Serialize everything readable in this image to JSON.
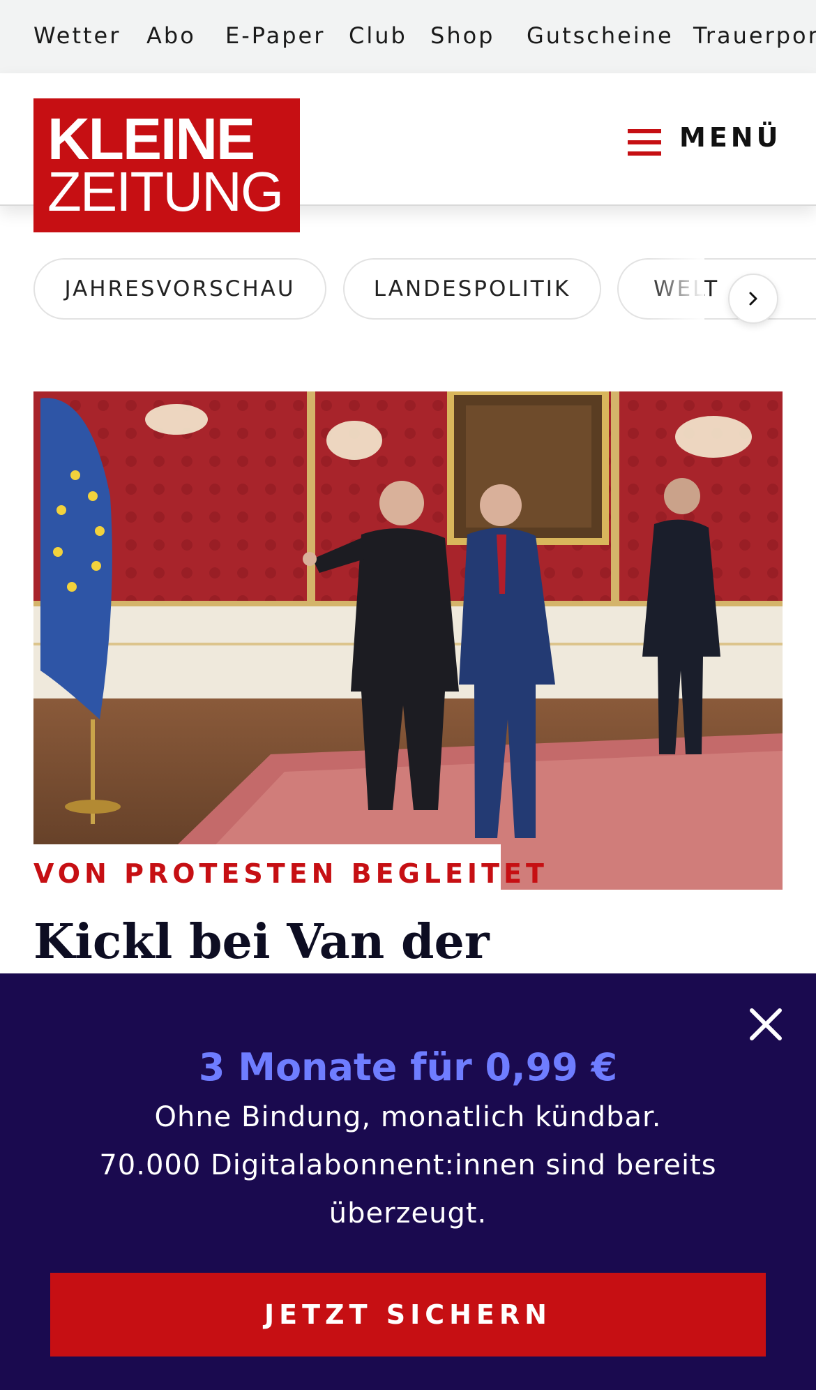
{
  "service_nav": {
    "items": [
      "Wetter",
      "Abo",
      "E-Paper",
      "Club",
      "Shop",
      "Gutscheine",
      "Trauerportal"
    ]
  },
  "header": {
    "logo_line1": "KLEINE",
    "logo_line2": "ZEITUNG",
    "menu_label": "MENÜ",
    "menu_icon": "hamburger-icon"
  },
  "categories": {
    "items": [
      "JAHRESVORSCHAU",
      "LANDESPOLITIK",
      "WELT"
    ],
    "next_icon": "chevron-right-icon"
  },
  "article": {
    "image_alt": "Zwei Männer im Anzug in einem Saal mit roten Wänden, Kronleuchtern und EU-Flagge",
    "kicker": "VON PROTESTEN BEGLEITET",
    "headline": "Kickl bei Van der"
  },
  "paywall": {
    "title": "3 Monate für 0,99 €",
    "line1": "Ohne Bindung, monatlich kündbar.",
    "line2": "70.000 Digitalabonnent:innen sind bereits",
    "line3": "überzeugt.",
    "cta_label": "JETZT SICHERN",
    "close_icon": "close-icon"
  },
  "colors": {
    "brand_red": "#c60f13",
    "paywall_bg": "#1a0a4f",
    "paywall_accent": "#6f7dff"
  }
}
